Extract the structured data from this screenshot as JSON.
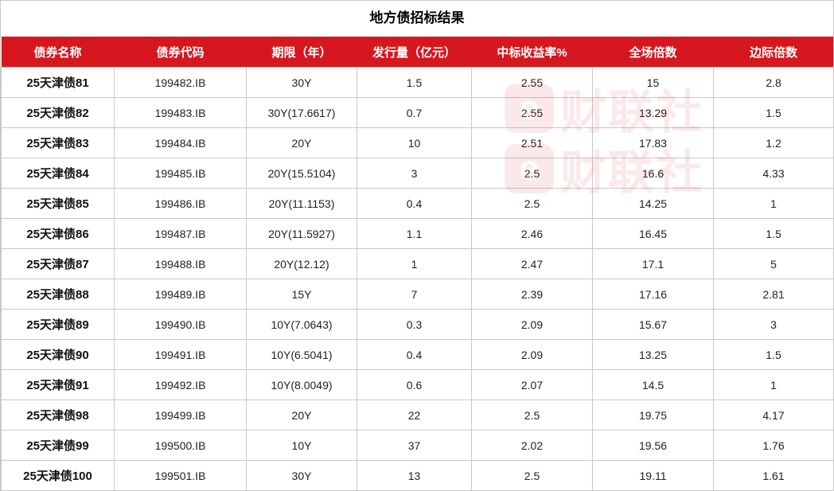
{
  "title": "地方债招标结果",
  "headers": [
    "债券名称",
    "债券代码",
    "期限（年）",
    "发行量（亿元）",
    "中标收益率%",
    "全场倍数",
    "边际倍数"
  ],
  "watermark": {
    "logo": "e",
    "text": "财联社"
  },
  "colors": {
    "header_bg": "#d7171f",
    "header_text": "#ffffff"
  },
  "rows": [
    [
      "25天津债81",
      "199482.IB",
      "30Y",
      "1.5",
      "2.55",
      "15",
      "2.8"
    ],
    [
      "25天津债82",
      "199483.IB",
      "30Y(17.6617)",
      "0.7",
      "2.55",
      "13.29",
      "1.5"
    ],
    [
      "25天津债83",
      "199484.IB",
      "20Y",
      "10",
      "2.51",
      "17.83",
      "1.2"
    ],
    [
      "25天津债84",
      "199485.IB",
      "20Y(15.5104)",
      "3",
      "2.5",
      "16.6",
      "4.33"
    ],
    [
      "25天津债85",
      "199486.IB",
      "20Y(11.1153)",
      "0.4",
      "2.5",
      "14.25",
      "1"
    ],
    [
      "25天津债86",
      "199487.IB",
      "20Y(11.5927)",
      "1.1",
      "2.46",
      "16.45",
      "1.5"
    ],
    [
      "25天津债87",
      "199488.IB",
      "20Y(12.12)",
      "1",
      "2.47",
      "17.1",
      "5"
    ],
    [
      "25天津债88",
      "199489.IB",
      "15Y",
      "7",
      "2.39",
      "17.16",
      "2.81"
    ],
    [
      "25天津债89",
      "199490.IB",
      "10Y(7.0643)",
      "0.3",
      "2.09",
      "15.67",
      "3"
    ],
    [
      "25天津债90",
      "199491.IB",
      "10Y(6.5041)",
      "0.4",
      "2.09",
      "13.25",
      "1.5"
    ],
    [
      "25天津债91",
      "199492.IB",
      "10Y(8.0049)",
      "0.6",
      "2.07",
      "14.5",
      "1"
    ],
    [
      "25天津债98",
      "199499.IB",
      "20Y",
      "22",
      "2.5",
      "19.75",
      "4.17"
    ],
    [
      "25天津债99",
      "199500.IB",
      "10Y",
      "37",
      "2.02",
      "19.56",
      "1.76"
    ],
    [
      "25天津债100",
      "199501.IB",
      "30Y",
      "13",
      "2.5",
      "19.11",
      "1.61"
    ]
  ]
}
